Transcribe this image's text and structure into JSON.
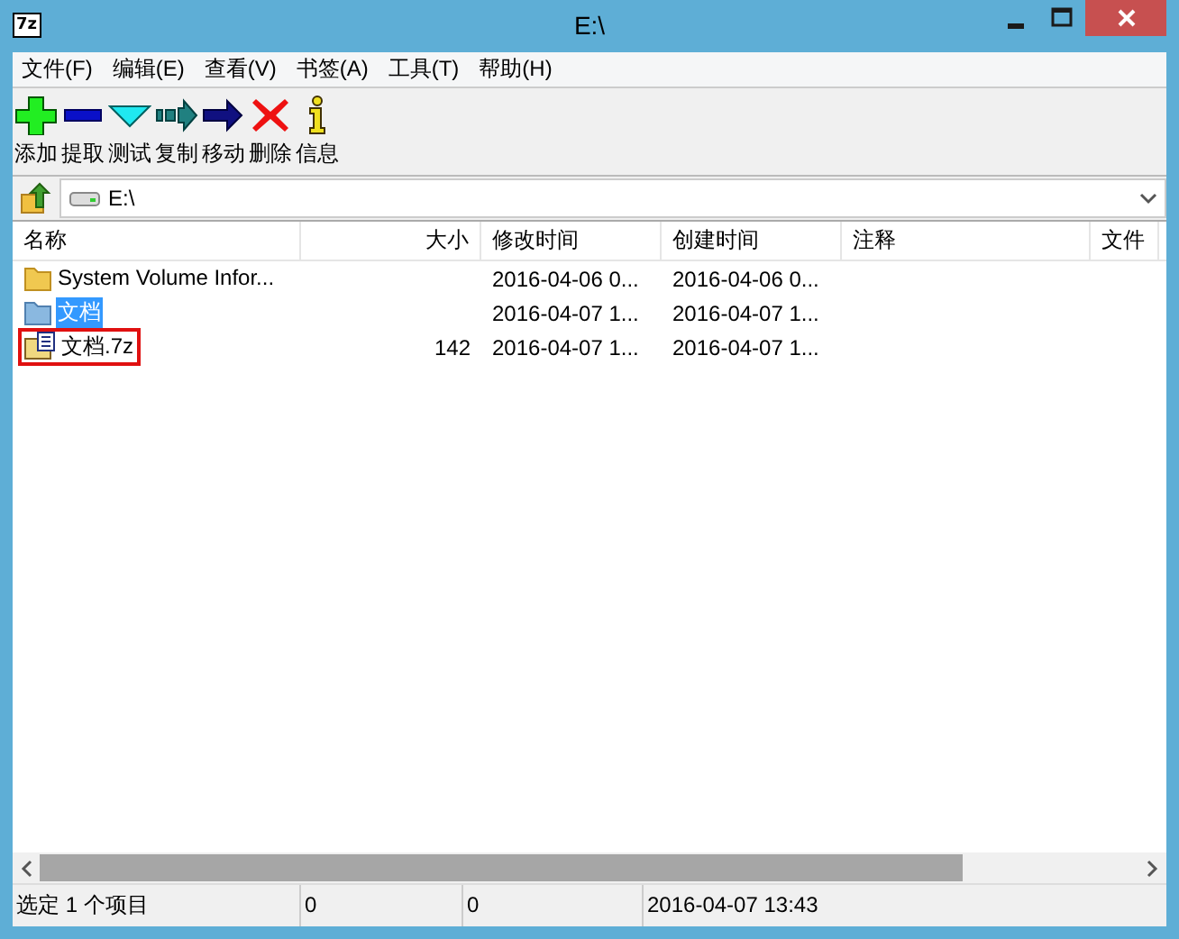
{
  "window": {
    "title": "E:\\",
    "logo": "7z"
  },
  "menu": [
    "文件(F)",
    "编辑(E)",
    "查看(V)",
    "书签(A)",
    "工具(T)",
    "帮助(H)"
  ],
  "toolbar": [
    {
      "kind": "add",
      "label": "添加"
    },
    {
      "kind": "extract",
      "label": "提取"
    },
    {
      "kind": "test",
      "label": "测试"
    },
    {
      "kind": "copy",
      "label": "复制"
    },
    {
      "kind": "move",
      "label": "移动"
    },
    {
      "kind": "delete",
      "label": "删除"
    },
    {
      "kind": "info",
      "label": "信息"
    }
  ],
  "address": {
    "value": "E:\\"
  },
  "table": {
    "columns": [
      "名称",
      "大小",
      "修改时间",
      "创建时间",
      "注释",
      "文件"
    ],
    "rows": [
      {
        "kind": "folder",
        "name": "System Volume Infor...",
        "size": "",
        "modified": "2016-04-06 0...",
        "created": "2016-04-06 0...",
        "selected": false,
        "outlined": false
      },
      {
        "kind": "folder",
        "name": "文档",
        "size": "",
        "modified": "2016-04-07 1...",
        "created": "2016-04-07 1...",
        "selected": true,
        "outlined": false
      },
      {
        "kind": "archive",
        "name": "文档.7z",
        "size": "142",
        "modified": "2016-04-07 1...",
        "created": "2016-04-07 1...",
        "selected": false,
        "outlined": true
      }
    ]
  },
  "status_bar": [
    "选定 1 个项目",
    "0",
    "0",
    "2016-04-07 13:43"
  ]
}
